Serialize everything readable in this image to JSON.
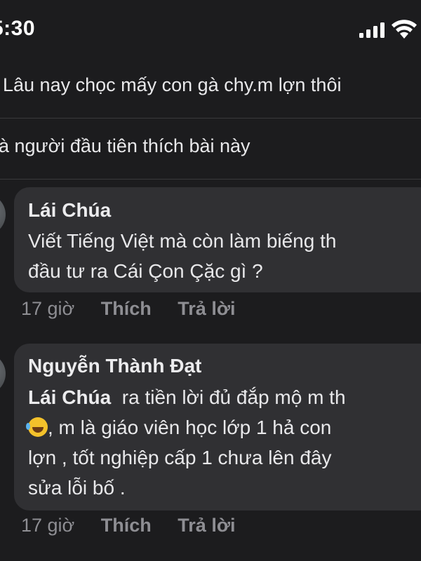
{
  "status_bar": {
    "time": "5:30",
    "signal_icon": "cellular-signal-icon",
    "wifi_icon": "wifi-icon"
  },
  "post": {
    "text": "Lâu nay chọc mấy con gà chy.m lợn thôi",
    "likes_text": "à người đầu tiên thích bài này"
  },
  "comments": [
    {
      "author": "Lái Chúa",
      "lines": [
        "Viết Tiếng Việt mà còn làm biếng th",
        "đầu tư ra Cái Çon Çặc gì ?"
      ],
      "time": "17 giờ",
      "like_label": "Thích",
      "reply_label": "Trả lời"
    },
    {
      "author": "Nguyễn Thành Đạt",
      "mention": "Lái Chúa",
      "lines": [
        "ra tiền lời đủ đắp mộ m th",
        ", m là giáo viên học lớp 1 hả con",
        "lợn , tốt nghiệp cấp 1 chưa lên đây",
        "sửa lỗi bố ."
      ],
      "emoji": "rolling-on-floor-laughing-emoji",
      "time": "17 giờ",
      "like_label": "Thích",
      "reply_label": "Trả lời"
    }
  ],
  "colors": {
    "background": "#1c1c1e",
    "bubble": "#303033",
    "text": "#e8e8ea",
    "muted": "#8e8e93"
  }
}
